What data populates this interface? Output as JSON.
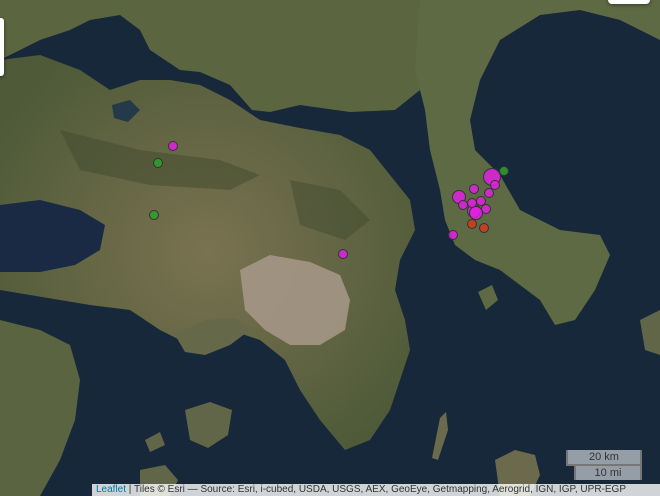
{
  "map": {
    "water_color": "#16283a",
    "land_color": "#6e6a48",
    "urban_color": "#a8998a",
    "markers": [
      {
        "type": "magenta",
        "color": "#e020e0",
        "size": "small"
      },
      {
        "type": "magenta",
        "color": "#e020e0",
        "size": "small"
      },
      {
        "type": "magenta",
        "color": "#e020e0",
        "size": "large"
      },
      {
        "type": "magenta",
        "color": "#e020e0",
        "size": "small"
      },
      {
        "type": "magenta",
        "color": "#e020e0",
        "size": "medium"
      },
      {
        "type": "magenta",
        "color": "#e020e0",
        "size": "small"
      },
      {
        "type": "magenta",
        "color": "#e020e0",
        "size": "medium"
      },
      {
        "type": "magenta",
        "color": "#e020e0",
        "size": "small"
      },
      {
        "type": "magenta",
        "color": "#e020e0",
        "size": "small"
      },
      {
        "type": "magenta",
        "color": "#e020e0",
        "size": "small"
      },
      {
        "type": "magenta",
        "color": "#e020e0",
        "size": "medium"
      },
      {
        "type": "magenta",
        "color": "#e020e0",
        "size": "small"
      },
      {
        "type": "magenta",
        "color": "#e020e0",
        "size": "small"
      },
      {
        "type": "magenta",
        "color": "#e020e0",
        "size": "small"
      },
      {
        "type": "green",
        "color": "#2ea02e",
        "size": "small"
      },
      {
        "type": "green",
        "color": "#2ea02e",
        "size": "small"
      },
      {
        "type": "green",
        "color": "#2ea02e",
        "size": "small"
      },
      {
        "type": "red",
        "color": "#d43a1a",
        "size": "small"
      },
      {
        "type": "red",
        "color": "#d43a1a",
        "size": "small"
      }
    ]
  },
  "scale": {
    "km_label": "20 km",
    "mi_label": "10 mi"
  },
  "attribution": {
    "link_label": "Leaflet",
    "text": " | Tiles © Esri — Source: Esri, i-cubed, USDA, USGS, AEX, GeoEye, Getmapping, Aerogrid, IGN, IGP, UPR-EGP"
  }
}
